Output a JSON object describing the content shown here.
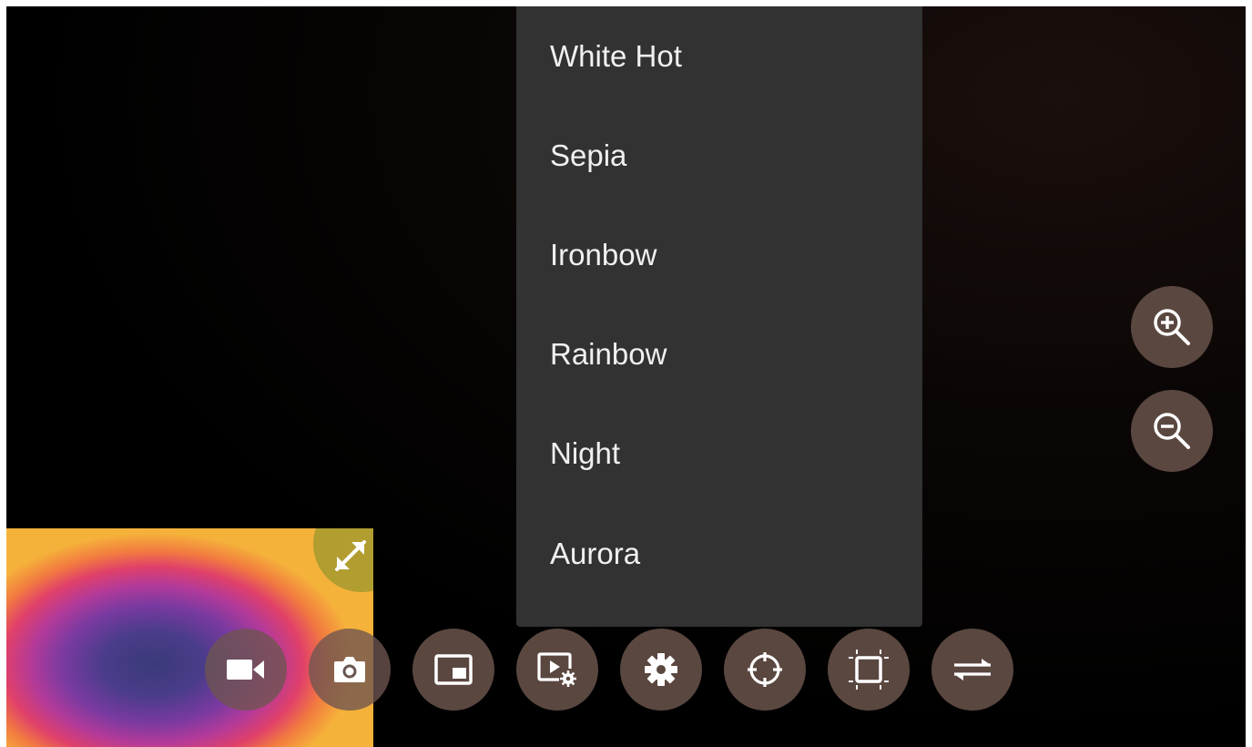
{
  "palette_menu": {
    "items": [
      {
        "label": "White Hot"
      },
      {
        "label": "Sepia"
      },
      {
        "label": "Ironbow"
      },
      {
        "label": "Rainbow"
      },
      {
        "label": "Night"
      },
      {
        "label": "Aurora"
      }
    ]
  },
  "zoom_controls": {
    "zoom_in_icon": "zoom-in-icon",
    "zoom_out_icon": "zoom-out-icon"
  },
  "toolbar": {
    "buttons": [
      {
        "icon": "video-camera-icon"
      },
      {
        "icon": "camera-icon"
      },
      {
        "icon": "picture-in-picture-icon"
      },
      {
        "icon": "playback-settings-icon"
      },
      {
        "icon": "gear-icon"
      },
      {
        "icon": "crosshair-icon"
      },
      {
        "icon": "crop-frame-icon"
      },
      {
        "icon": "swap-arrows-icon"
      }
    ]
  },
  "pip": {
    "expand_icon": "expand-arrows-icon"
  },
  "colors": {
    "menu_bg": "#323232",
    "menu_text": "#f0f0f0",
    "fab_bg": "#5a4740"
  }
}
